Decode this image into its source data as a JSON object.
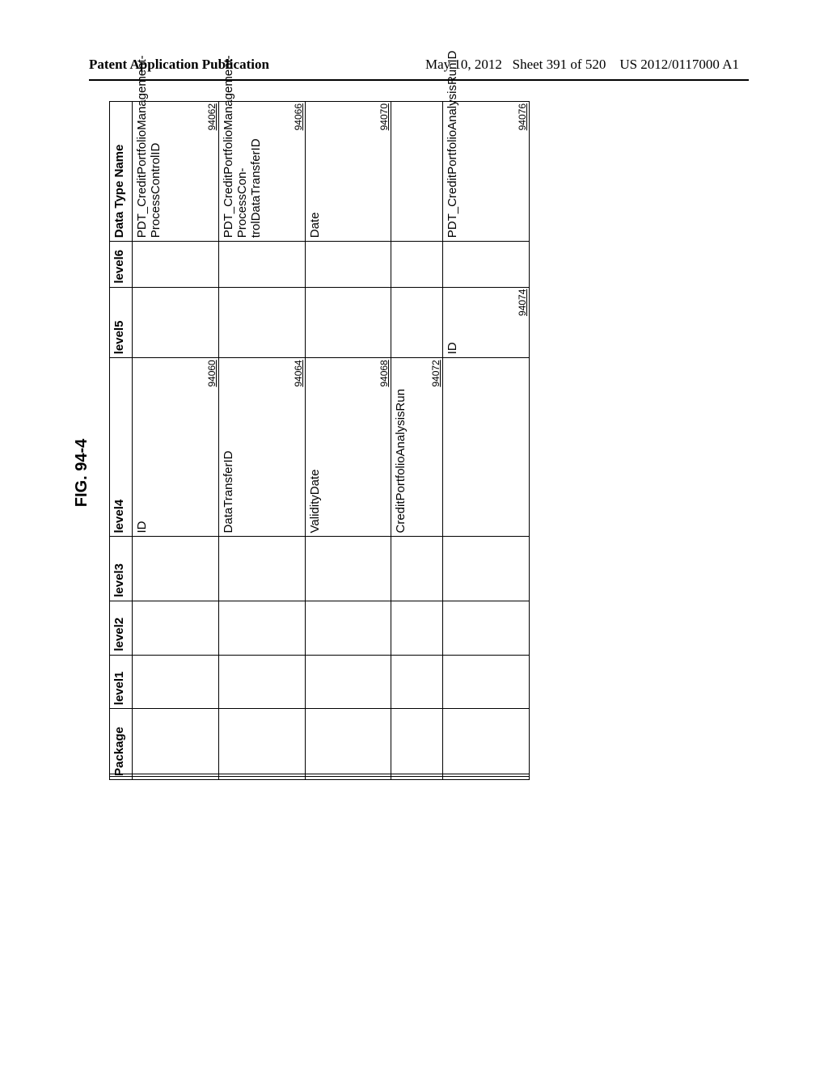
{
  "header": {
    "left": "Patent Application Publication",
    "date": "May 10, 2012",
    "sheet": "Sheet 391 of 520",
    "pubno": "US 2012/0117000 A1"
  },
  "figure_label": "FIG. 94-4",
  "columns": {
    "package": "Package",
    "level1": "level1",
    "level2": "level2",
    "level3": "level3",
    "level4": "level4",
    "level5": "level5",
    "level6": "level6",
    "datatype": "Data Type Name"
  },
  "rows": [
    {
      "level4": "ID",
      "level4_ref": "94060",
      "datatype": "PDT_CreditPortfolioManagement-ProcessControlID",
      "datatype_ref": "94062"
    },
    {
      "level4": "DataTransferID",
      "level4_ref": "94064",
      "datatype": "PDT_CreditPortfolioManagement-ProcessCon-trolDataTransferID",
      "datatype_ref": "94066"
    },
    {
      "level4": "ValidityDate",
      "level4_ref": "94068",
      "datatype": "Date",
      "datatype_ref": "94070"
    },
    {
      "level4": "CreditPortfolioAnalysisRun",
      "level4_ref": "94072"
    },
    {
      "level5": "ID",
      "level5_ref": "94074",
      "datatype": "PDT_CreditPortfolioAnalysisRunID",
      "datatype_ref": "94076"
    }
  ]
}
